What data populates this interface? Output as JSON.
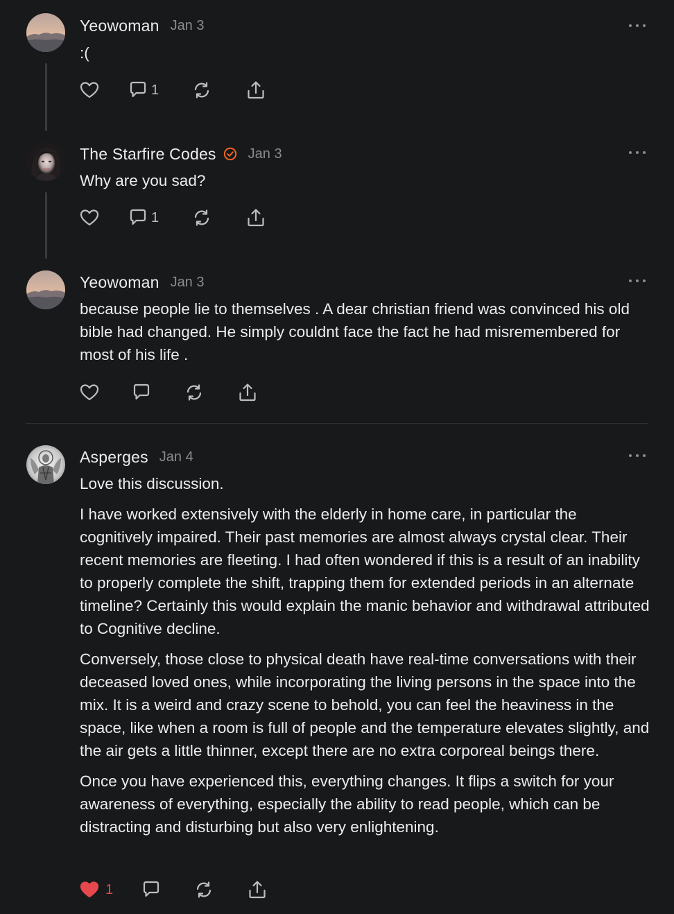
{
  "colors": {
    "background": "#18191b",
    "text": "#ececee",
    "muted": "#8b8c90",
    "verified": "#f26522",
    "liked": "#e5484d"
  },
  "comments": [
    {
      "author": "Yeowoman",
      "date": "Jan 3",
      "avatar": "landscape-avatar",
      "paragraphs": [
        ":("
      ],
      "like_count": "",
      "reply_count": "1",
      "liked": false
    },
    {
      "author": "The Starfire Codes",
      "verified": true,
      "date": "Jan 3",
      "avatar": "portrait-avatar",
      "paragraphs": [
        "Why are you sad?"
      ],
      "like_count": "",
      "reply_count": "1",
      "liked": false
    },
    {
      "author": "Yeowoman",
      "date": "Jan 3",
      "avatar": "landscape-avatar",
      "paragraphs": [
        "because people lie to themselves . A dear christian friend was convinced his old bible had changed. He simply couldnt face the fact he had misremembered for most of his life ."
      ],
      "like_count": "",
      "reply_count": "",
      "liked": false
    },
    {
      "author": "Asperges",
      "date": "Jan 4",
      "avatar": "icon-saint-avatar",
      "paragraphs": [
        "Love this discussion.",
        "I have worked extensively with the elderly in home care, in particular the cognitively impaired. Their past memories are almost always crystal clear. Their recent memories are fleeting. I had often wondered if this is a result of an inability to properly complete the shift, trapping them for extended periods in an alternate timeline? Certainly this would explain the manic behavior and withdrawal attributed to Cognitive decline.",
        "Conversely, those close to physical death have real-time conversations with their deceased loved ones, while incorporating the living persons in the space into the mix. It is a weird and crazy scene to behold, you can feel the heaviness in the space, like when a room is full of people and the temperature elevates slightly, and the air gets a little thinner, except there are no extra corporeal beings there.",
        "Once you have experienced this, everything changes. It flips a switch for your awareness of everything, especially the ability to read people, which can be distracting and disturbing but also very enlightening."
      ],
      "like_count": "1",
      "reply_count": "",
      "liked": true
    }
  ],
  "icons": {
    "like": "heart-icon",
    "reply": "speech-bubble-icon",
    "restack": "restack-icon",
    "share": "share-icon",
    "more": "more-dots-icon",
    "verified": "verified-check-icon"
  }
}
